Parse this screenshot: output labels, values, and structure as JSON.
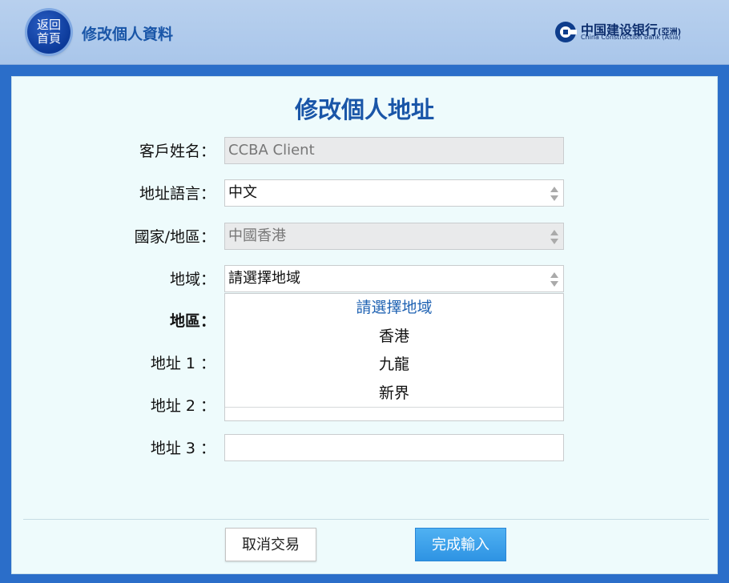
{
  "header": {
    "home_line1": "返回",
    "home_line2": "首頁",
    "title": "修改個人資料",
    "bank_cn": "中国建设银行",
    "bank_cn_suffix": "(亞洲)",
    "bank_en": "China Construction Bank (Asia)"
  },
  "form": {
    "title": "修改個人地址",
    "fields": {
      "name_label": "客戶姓名：",
      "name_value": "CCBA Client",
      "language_label": "地址語言：",
      "language_value": "中文",
      "country_label": "國家/地區：",
      "country_value": "中國香港",
      "region_label": "地域：",
      "region_value": "請選擇地域",
      "district_label": "地區：",
      "address1_label": "地址 1 ：",
      "address2_label": "地址 2 ：",
      "address3_label": "地址 3 ：",
      "address3_value": ""
    },
    "region_options": [
      "請選擇地域",
      "香港",
      "九龍",
      "新界"
    ]
  },
  "buttons": {
    "cancel": "取消交易",
    "done": "完成輸入"
  },
  "colors": {
    "accent": "#1a56a8",
    "frame": "#2b6ec9",
    "done_button": "#3a9ee8"
  }
}
